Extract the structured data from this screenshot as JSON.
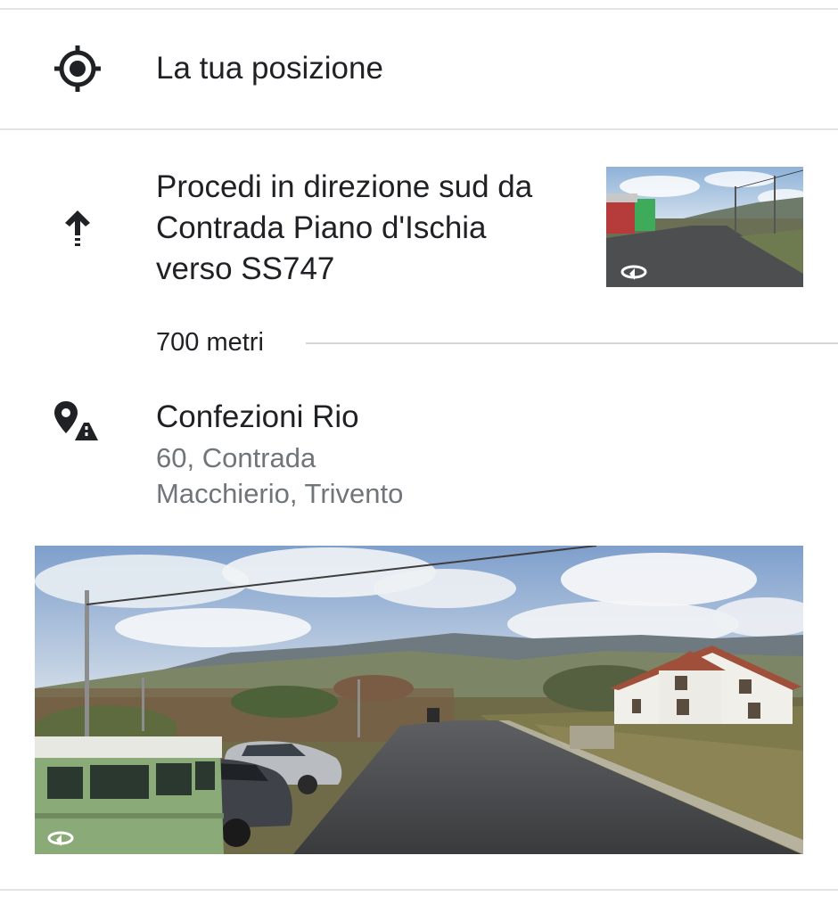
{
  "origin": {
    "label": "La tua posizione",
    "icon": "my-location-icon"
  },
  "step": {
    "icon": "arrow-up-icon",
    "instruction_lines": [
      "Procedi in direzione sud da",
      "Contrada Piano d'Ischia",
      "verso SS747"
    ],
    "distance": "700 metri",
    "thumbnail_icon": "street-view-360-icon"
  },
  "destination": {
    "icon": "destination-pin-road-icon",
    "name": "Confezioni Rio",
    "address_lines": [
      "60, Contrada",
      "Macchierio, Trivento"
    ],
    "photo_icon": "street-view-360-icon"
  },
  "colors": {
    "primary_text": "#202124",
    "secondary_text": "#70757a",
    "divider": "#e3e3e3"
  }
}
